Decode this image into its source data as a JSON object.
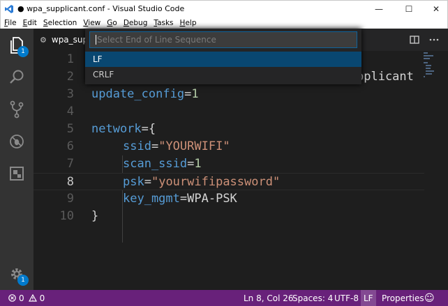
{
  "window": {
    "title": "● wpa_supplicant.conf - Visual Studio Code",
    "minimize": "—",
    "maximize": "☐",
    "close": "✕"
  },
  "menu": [
    {
      "accel": "F",
      "rest": "ile"
    },
    {
      "accel": "E",
      "rest": "dit"
    },
    {
      "accel": "S",
      "rest": "election"
    },
    {
      "accel": "V",
      "rest": "iew"
    },
    {
      "accel": "G",
      "rest": "o"
    },
    {
      "accel": "D",
      "rest": "ebug"
    },
    {
      "accel": "T",
      "rest": "asks"
    },
    {
      "accel": "H",
      "rest": "elp"
    }
  ],
  "activity": {
    "explorer_badge": "1",
    "settings_badge": "1"
  },
  "tab": {
    "label": "wpa_supp"
  },
  "editor": {
    "line_numbers": [
      "1",
      "2",
      "3",
      "4",
      "5",
      "6",
      "7",
      "8",
      "9",
      "10"
    ],
    "line2_visible": "pplicant",
    "line3": {
      "key": "update_config",
      "eq": "=",
      "val": "1"
    },
    "line5": {
      "key": "network",
      "eq": "=",
      "brace": "{"
    },
    "line6": {
      "key": "ssid",
      "eq": "=",
      "val": "\"YOURWIFI\""
    },
    "line7": {
      "key": "scan_ssid",
      "eq": "=",
      "val": "1"
    },
    "line8": {
      "key": "psk",
      "eq": "=",
      "val": "\"yourwifipassword\""
    },
    "line9": {
      "key": "key_mgmt",
      "eq": "=",
      "val": "WPA-PSK"
    },
    "line10": {
      "brace": "}"
    }
  },
  "quickpick": {
    "placeholder": "Select End of Line Sequence",
    "items": [
      "LF",
      "CRLF"
    ]
  },
  "statusbar": {
    "errors": "0",
    "warnings": "0",
    "position": "Ln 8, Col 26",
    "spaces": "Spaces: 4",
    "encoding": "UTF-8",
    "eol": "LF",
    "language": "Properties",
    "feedback_icon": "☺"
  },
  "colors": {
    "statusbar": "#68217a",
    "activitybar": "#333333",
    "editor_bg": "#1e1e1e",
    "badge": "#007acc",
    "selected_item": "#094771"
  }
}
